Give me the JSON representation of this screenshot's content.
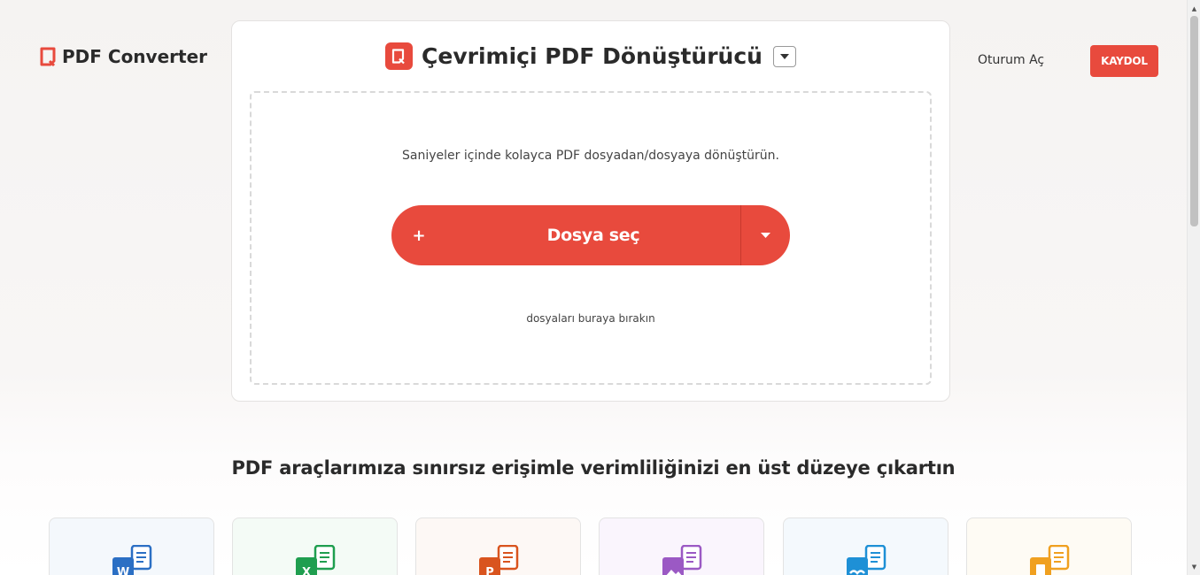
{
  "header": {
    "logo_text": "PDF Converter",
    "login_label": "Oturum Aç",
    "signup_label": "KAYDOL"
  },
  "converter": {
    "title": "Çevrimiçi PDF Dönüştürücü",
    "subtitle": "Saniyeler içinde kolayca PDF dosyadan/dosyaya dönüştürün.",
    "plus_symbol": "+",
    "choose_file_label": "Dosya seç",
    "drop_hint": "dosyaları buraya bırakın"
  },
  "tools": {
    "heading": "PDF araçlarımıza sınırsız erişimle verimliliğinizi en üst düzeye çıkartın",
    "cards": [
      {
        "icon": "word-pdf-icon",
        "letter": "W",
        "color": "#2b6fc4",
        "bg": "#f4f8fc"
      },
      {
        "icon": "excel-pdf-icon",
        "letter": "X",
        "color": "#1f9e4f",
        "bg": "#f4fbf6"
      },
      {
        "icon": "powerpoint-pdf-icon",
        "letter": "P",
        "color": "#d9541e",
        "bg": "#fdf8f5"
      },
      {
        "icon": "image-pdf-icon",
        "letter": "",
        "color": "#9b59c4",
        "bg": "#faf5fd"
      },
      {
        "icon": "openoffice-pdf-icon",
        "letter": "",
        "color": "#1e90d6",
        "bg": "#f4f9fd"
      },
      {
        "icon": "pages-pdf-icon",
        "letter": "",
        "color": "#f0a020",
        "bg": "#fefbf4"
      }
    ]
  },
  "colors": {
    "accent": "#e84a3d"
  }
}
